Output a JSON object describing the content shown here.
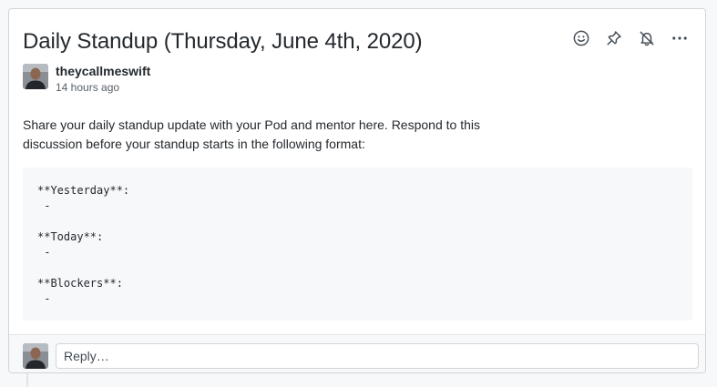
{
  "discussion": {
    "title": "Daily Standup (Thursday, June 4th, 2020)",
    "author": "theycallmeswift",
    "time": "14 hours ago",
    "description_line1": "Share your daily standup update with your Pod and mentor here. Respond to this",
    "description_line2": "discussion before your standup starts in the following format:",
    "code_lines": [
      "**Yesterday**:",
      " -",
      "",
      "**Today**:",
      " -",
      "",
      "**Blockers**:",
      " -"
    ]
  },
  "actions": {
    "icons": [
      "smiley-icon",
      "pin-icon",
      "bell-slash-icon",
      "kebab-horizontal-icon"
    ]
  },
  "reply": {
    "placeholder": "Reply…"
  },
  "colors": {
    "text": "#24292e",
    "muted": "#586069",
    "border": "#d1d5da",
    "code_bg": "#f6f8fa"
  }
}
